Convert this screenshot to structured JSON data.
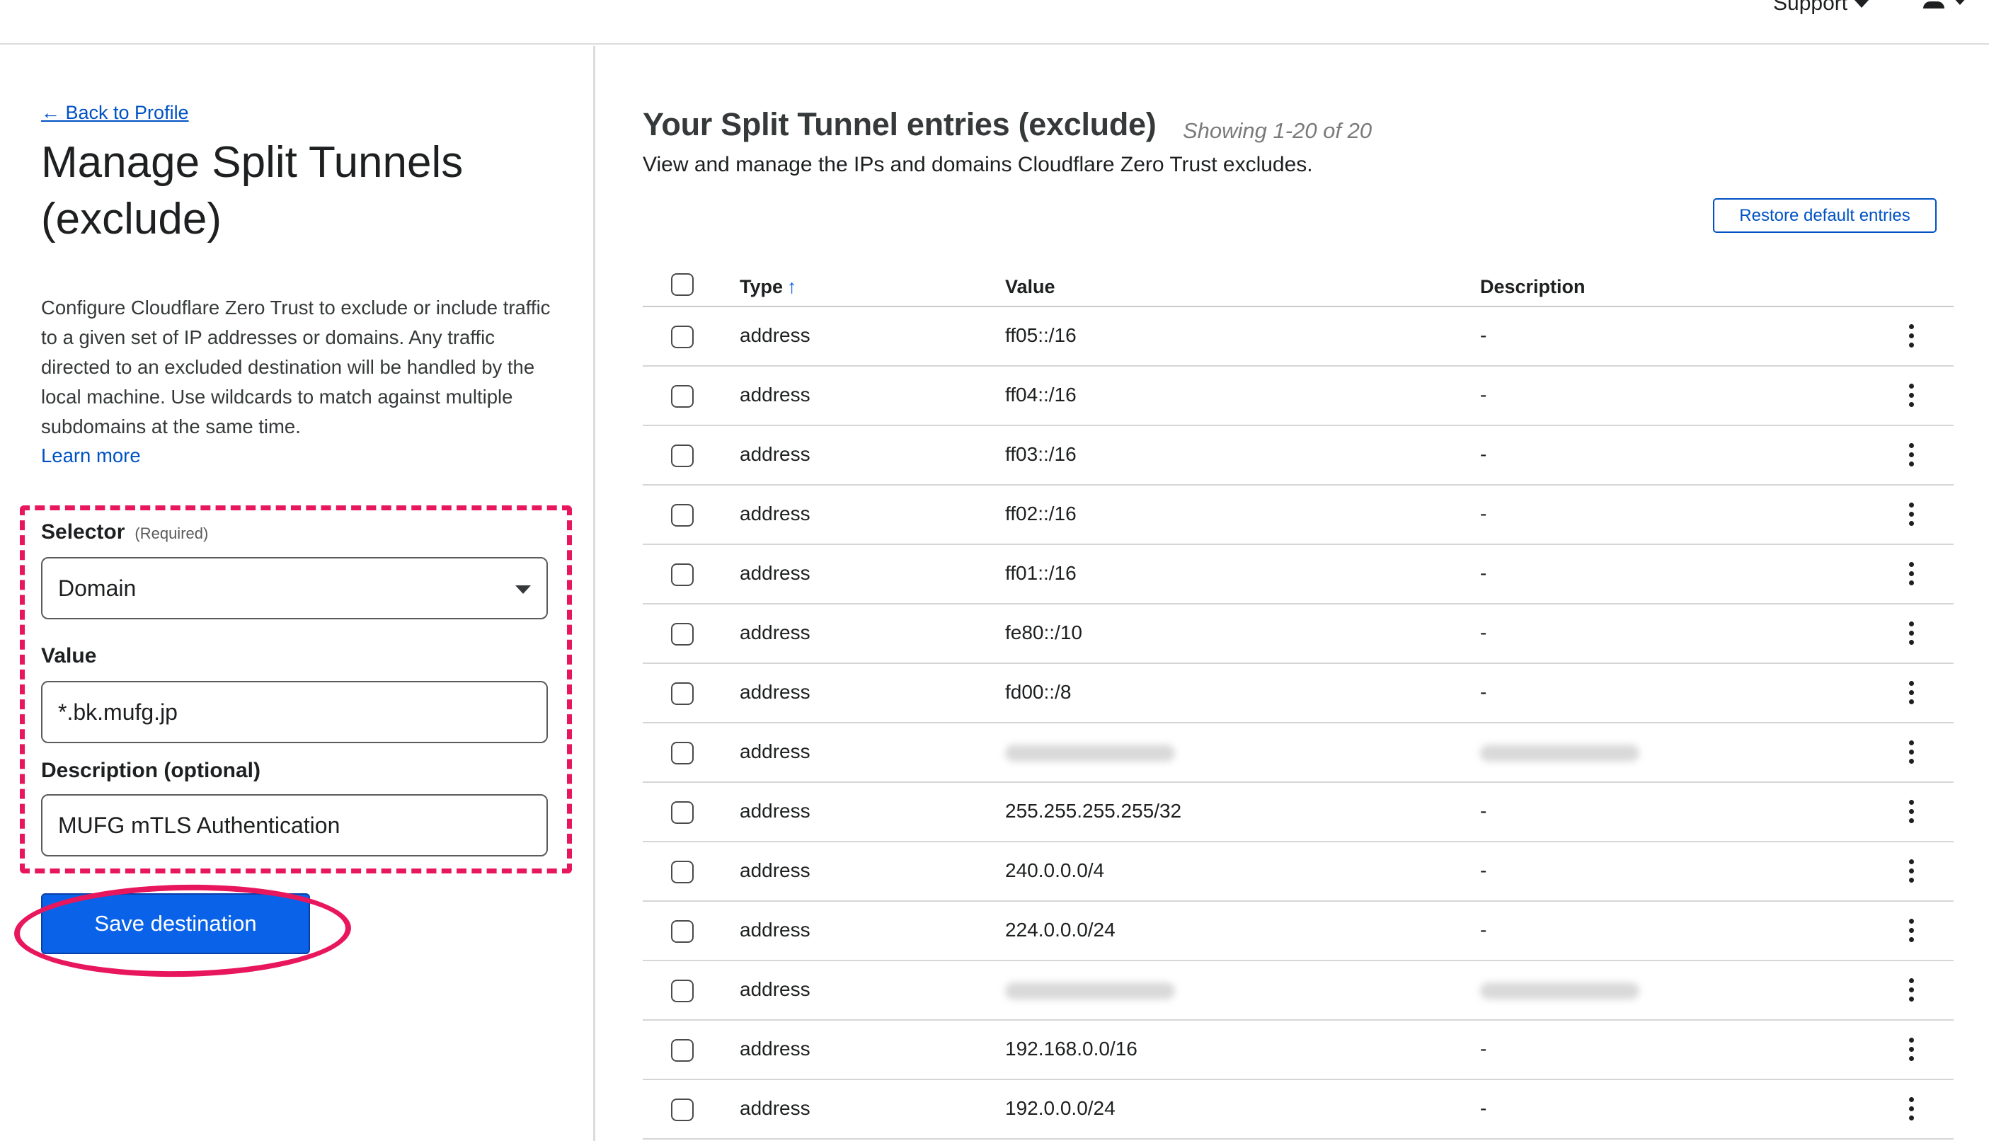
{
  "header": {
    "support_label": "Support"
  },
  "left": {
    "back_link": "← Back to Profile",
    "title": "Manage Split Tunnels (exclude)",
    "description": "Configure Cloudflare Zero Trust to exclude or include traffic to a given set of IP addresses or domains. Any traffic directed to an excluded destination will be handled by the local machine. Use wildcards to match against multiple subdomains at the same time.",
    "learn_more": "Learn more",
    "selector_label": "Selector",
    "selector_required": "(Required)",
    "selector_value": "Domain",
    "value_label": "Value",
    "value_value": "*.bk.mufg.jp",
    "description_label": "Description (optional)",
    "description_value": "MUFG mTLS Authentication",
    "save_button": "Save destination"
  },
  "right": {
    "title": "Your Split Tunnel entries (exclude)",
    "showing": "Showing 1-20 of 20",
    "subtitle": "View and manage the IPs and domains Cloudflare Zero Trust excludes.",
    "restore_button": "Restore default entries",
    "columns": {
      "type": "Type",
      "value": "Value",
      "description": "Description"
    },
    "rows": [
      {
        "type": "address",
        "value": "ff05::/16",
        "description": "-"
      },
      {
        "type": "address",
        "value": "ff04::/16",
        "description": "-"
      },
      {
        "type": "address",
        "value": "ff03::/16",
        "description": "-"
      },
      {
        "type": "address",
        "value": "ff02::/16",
        "description": "-"
      },
      {
        "type": "address",
        "value": "ff01::/16",
        "description": "-"
      },
      {
        "type": "address",
        "value": "fe80::/10",
        "description": "-"
      },
      {
        "type": "address",
        "value": "fd00::/8",
        "description": "-"
      },
      {
        "type": "address",
        "value": "",
        "description": ""
      },
      {
        "type": "address",
        "value": "255.255.255.255/32",
        "description": "-"
      },
      {
        "type": "address",
        "value": "240.0.0.0/4",
        "description": "-"
      },
      {
        "type": "address",
        "value": "224.0.0.0/24",
        "description": "-"
      },
      {
        "type": "address",
        "value": "",
        "description": ""
      },
      {
        "type": "address",
        "value": "192.168.0.0/16",
        "description": "-"
      },
      {
        "type": "address",
        "value": "192.0.0.0/24",
        "description": "-"
      }
    ]
  }
}
